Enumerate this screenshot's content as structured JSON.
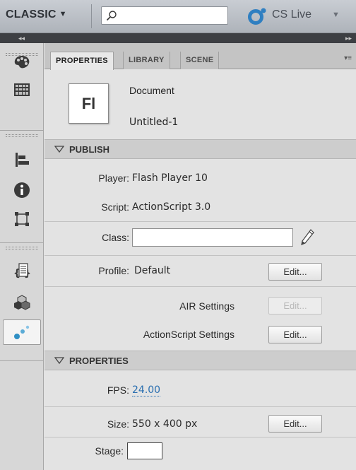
{
  "appbar": {
    "workspace_label": "CLASSIC",
    "search_value": "",
    "cs_live_label": "CS Live"
  },
  "tabs": [
    "PROPERTIES",
    "LIBRARY",
    "SCENE"
  ],
  "document": {
    "icon_text": "Fl",
    "type": "Document",
    "name": "Untitled-1"
  },
  "publish": {
    "header": "PUBLISH",
    "player_label": "Player:",
    "player_value": "Flash Player 10",
    "script_label": "Script:",
    "script_value": "ActionScript 3.0",
    "class_label": "Class:",
    "class_value": "",
    "profile_label": "Profile:",
    "profile_value": "Default",
    "profile_edit": "Edit...",
    "air_label": "AIR Settings",
    "air_edit": "Edit...",
    "as_label": "ActionScript Settings",
    "as_edit": "Edit..."
  },
  "properties": {
    "header": "PROPERTIES",
    "fps_label": "FPS:",
    "fps_value": "24.00",
    "size_label": "Size:",
    "size_value": "550 x 400 px",
    "size_edit": "Edit...",
    "stage_label": "Stage:",
    "stage_color": "#ffffff"
  },
  "colors": {
    "link": "#2a6fb0",
    "cs_live_icon": "#2f7fc1"
  }
}
